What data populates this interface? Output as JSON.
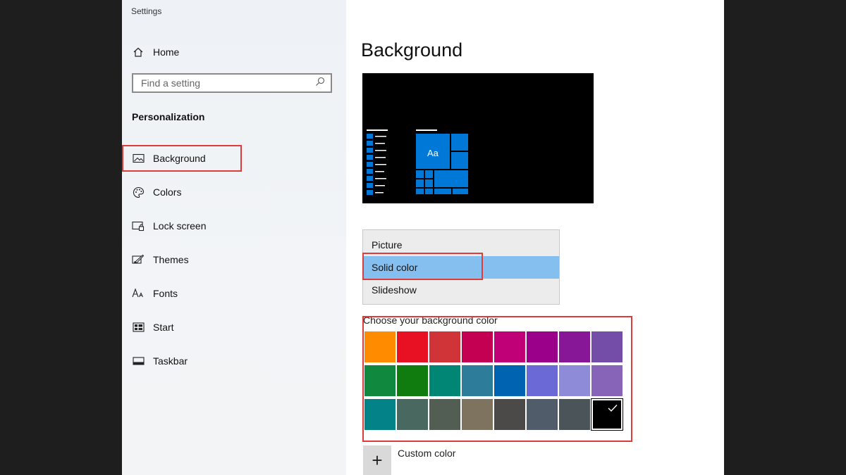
{
  "window": {
    "title": "Settings"
  },
  "sidebar": {
    "home": {
      "label": "Home",
      "icon": "home-icon"
    },
    "search": {
      "placeholder": "Find a setting",
      "icon": "search-icon"
    },
    "section_title": "Personalization",
    "items": [
      {
        "label": "Background",
        "icon": "image-icon",
        "active": true
      },
      {
        "label": "Colors",
        "icon": "palette-icon"
      },
      {
        "label": "Lock screen",
        "icon": "lock-screen-icon"
      },
      {
        "label": "Themes",
        "icon": "themes-icon"
      },
      {
        "label": "Fonts",
        "icon": "fonts-icon"
      },
      {
        "label": "Start",
        "icon": "start-icon"
      },
      {
        "label": "Taskbar",
        "icon": "taskbar-icon"
      }
    ]
  },
  "main": {
    "title": "Background",
    "preview": {
      "tile_text": "Aa",
      "accent": "#0078d7"
    },
    "dropdown": {
      "options": [
        "Picture",
        "Solid color",
        "Slideshow"
      ],
      "selected": "Solid color"
    },
    "choose_color_label": "Choose your background color",
    "colors": [
      [
        "#ff8c00",
        "#e81123",
        "#d13438",
        "#c30052",
        "#bf0077",
        "#9a0089",
        "#881798",
        "#744da9"
      ],
      [
        "#10893e",
        "#107c10",
        "#018574",
        "#2d7d9a",
        "#0063b1",
        "#6b69d6",
        "#8e8cd8",
        "#8764b8"
      ],
      [
        "#038387",
        "#486860",
        "#525e54",
        "#7e735f",
        "#4c4a48",
        "#515c6b",
        "#4a5459",
        "#000000"
      ]
    ],
    "selected_color": "#000000",
    "custom_color": {
      "label": "Custom color",
      "button_symbol": "+"
    }
  },
  "highlight_color": "#e03b3b"
}
